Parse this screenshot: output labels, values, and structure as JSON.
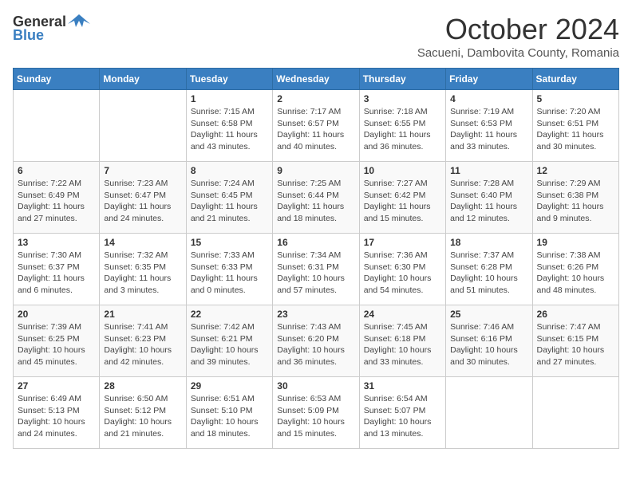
{
  "header": {
    "logo_general": "General",
    "logo_blue": "Blue",
    "month": "October 2024",
    "location": "Sacueni, Dambovita County, Romania"
  },
  "weekdays": [
    "Sunday",
    "Monday",
    "Tuesday",
    "Wednesday",
    "Thursday",
    "Friday",
    "Saturday"
  ],
  "weeks": [
    [
      {
        "day": null,
        "sunrise": null,
        "sunset": null,
        "daylight": null
      },
      {
        "day": null,
        "sunrise": null,
        "sunset": null,
        "daylight": null
      },
      {
        "day": "1",
        "sunrise": "Sunrise: 7:15 AM",
        "sunset": "Sunset: 6:58 PM",
        "daylight": "Daylight: 11 hours and 43 minutes."
      },
      {
        "day": "2",
        "sunrise": "Sunrise: 7:17 AM",
        "sunset": "Sunset: 6:57 PM",
        "daylight": "Daylight: 11 hours and 40 minutes."
      },
      {
        "day": "3",
        "sunrise": "Sunrise: 7:18 AM",
        "sunset": "Sunset: 6:55 PM",
        "daylight": "Daylight: 11 hours and 36 minutes."
      },
      {
        "day": "4",
        "sunrise": "Sunrise: 7:19 AM",
        "sunset": "Sunset: 6:53 PM",
        "daylight": "Daylight: 11 hours and 33 minutes."
      },
      {
        "day": "5",
        "sunrise": "Sunrise: 7:20 AM",
        "sunset": "Sunset: 6:51 PM",
        "daylight": "Daylight: 11 hours and 30 minutes."
      }
    ],
    [
      {
        "day": "6",
        "sunrise": "Sunrise: 7:22 AM",
        "sunset": "Sunset: 6:49 PM",
        "daylight": "Daylight: 11 hours and 27 minutes."
      },
      {
        "day": "7",
        "sunrise": "Sunrise: 7:23 AM",
        "sunset": "Sunset: 6:47 PM",
        "daylight": "Daylight: 11 hours and 24 minutes."
      },
      {
        "day": "8",
        "sunrise": "Sunrise: 7:24 AM",
        "sunset": "Sunset: 6:45 PM",
        "daylight": "Daylight: 11 hours and 21 minutes."
      },
      {
        "day": "9",
        "sunrise": "Sunrise: 7:25 AM",
        "sunset": "Sunset: 6:44 PM",
        "daylight": "Daylight: 11 hours and 18 minutes."
      },
      {
        "day": "10",
        "sunrise": "Sunrise: 7:27 AM",
        "sunset": "Sunset: 6:42 PM",
        "daylight": "Daylight: 11 hours and 15 minutes."
      },
      {
        "day": "11",
        "sunrise": "Sunrise: 7:28 AM",
        "sunset": "Sunset: 6:40 PM",
        "daylight": "Daylight: 11 hours and 12 minutes."
      },
      {
        "day": "12",
        "sunrise": "Sunrise: 7:29 AM",
        "sunset": "Sunset: 6:38 PM",
        "daylight": "Daylight: 11 hours and 9 minutes."
      }
    ],
    [
      {
        "day": "13",
        "sunrise": "Sunrise: 7:30 AM",
        "sunset": "Sunset: 6:37 PM",
        "daylight": "Daylight: 11 hours and 6 minutes."
      },
      {
        "day": "14",
        "sunrise": "Sunrise: 7:32 AM",
        "sunset": "Sunset: 6:35 PM",
        "daylight": "Daylight: 11 hours and 3 minutes."
      },
      {
        "day": "15",
        "sunrise": "Sunrise: 7:33 AM",
        "sunset": "Sunset: 6:33 PM",
        "daylight": "Daylight: 11 hours and 0 minutes."
      },
      {
        "day": "16",
        "sunrise": "Sunrise: 7:34 AM",
        "sunset": "Sunset: 6:31 PM",
        "daylight": "Daylight: 10 hours and 57 minutes."
      },
      {
        "day": "17",
        "sunrise": "Sunrise: 7:36 AM",
        "sunset": "Sunset: 6:30 PM",
        "daylight": "Daylight: 10 hours and 54 minutes."
      },
      {
        "day": "18",
        "sunrise": "Sunrise: 7:37 AM",
        "sunset": "Sunset: 6:28 PM",
        "daylight": "Daylight: 10 hours and 51 minutes."
      },
      {
        "day": "19",
        "sunrise": "Sunrise: 7:38 AM",
        "sunset": "Sunset: 6:26 PM",
        "daylight": "Daylight: 10 hours and 48 minutes."
      }
    ],
    [
      {
        "day": "20",
        "sunrise": "Sunrise: 7:39 AM",
        "sunset": "Sunset: 6:25 PM",
        "daylight": "Daylight: 10 hours and 45 minutes."
      },
      {
        "day": "21",
        "sunrise": "Sunrise: 7:41 AM",
        "sunset": "Sunset: 6:23 PM",
        "daylight": "Daylight: 10 hours and 42 minutes."
      },
      {
        "day": "22",
        "sunrise": "Sunrise: 7:42 AM",
        "sunset": "Sunset: 6:21 PM",
        "daylight": "Daylight: 10 hours and 39 minutes."
      },
      {
        "day": "23",
        "sunrise": "Sunrise: 7:43 AM",
        "sunset": "Sunset: 6:20 PM",
        "daylight": "Daylight: 10 hours and 36 minutes."
      },
      {
        "day": "24",
        "sunrise": "Sunrise: 7:45 AM",
        "sunset": "Sunset: 6:18 PM",
        "daylight": "Daylight: 10 hours and 33 minutes."
      },
      {
        "day": "25",
        "sunrise": "Sunrise: 7:46 AM",
        "sunset": "Sunset: 6:16 PM",
        "daylight": "Daylight: 10 hours and 30 minutes."
      },
      {
        "day": "26",
        "sunrise": "Sunrise: 7:47 AM",
        "sunset": "Sunset: 6:15 PM",
        "daylight": "Daylight: 10 hours and 27 minutes."
      }
    ],
    [
      {
        "day": "27",
        "sunrise": "Sunrise: 6:49 AM",
        "sunset": "Sunset: 5:13 PM",
        "daylight": "Daylight: 10 hours and 24 minutes."
      },
      {
        "day": "28",
        "sunrise": "Sunrise: 6:50 AM",
        "sunset": "Sunset: 5:12 PM",
        "daylight": "Daylight: 10 hours and 21 minutes."
      },
      {
        "day": "29",
        "sunrise": "Sunrise: 6:51 AM",
        "sunset": "Sunset: 5:10 PM",
        "daylight": "Daylight: 10 hours and 18 minutes."
      },
      {
        "day": "30",
        "sunrise": "Sunrise: 6:53 AM",
        "sunset": "Sunset: 5:09 PM",
        "daylight": "Daylight: 10 hours and 15 minutes."
      },
      {
        "day": "31",
        "sunrise": "Sunrise: 6:54 AM",
        "sunset": "Sunset: 5:07 PM",
        "daylight": "Daylight: 10 hours and 13 minutes."
      },
      {
        "day": null,
        "sunrise": null,
        "sunset": null,
        "daylight": null
      },
      {
        "day": null,
        "sunrise": null,
        "sunset": null,
        "daylight": null
      }
    ]
  ]
}
